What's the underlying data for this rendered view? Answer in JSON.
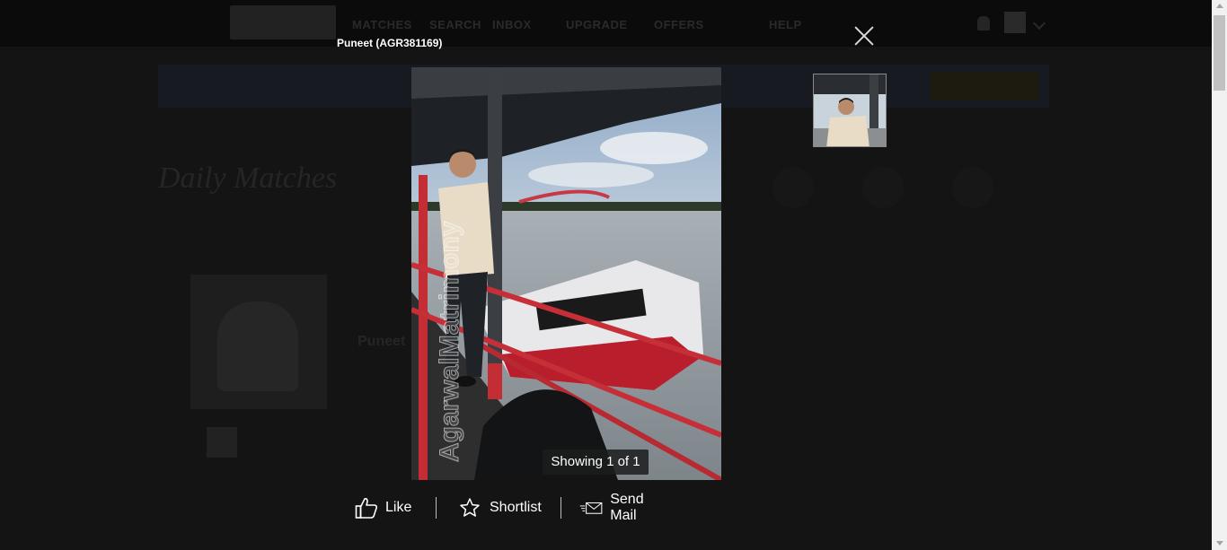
{
  "modal": {
    "title": "Puneet (AGR381169)",
    "caption": "Showing 1 of 1",
    "actions": {
      "like": "Like",
      "shortlist": "Shortlist",
      "send_mail": "Send Mail"
    },
    "watermark": "AgarwalMatrimony"
  },
  "background_page": {
    "nav": [
      "MATCHES",
      "SEARCH",
      "INBOX",
      "UPGRADE",
      "OFFERS",
      "HELP"
    ],
    "heading": "Daily Matches",
    "profile_name": "Puneet"
  },
  "icons": {
    "close": "close-icon",
    "like": "thumbs-up-icon",
    "shortlist": "star-icon",
    "send_mail": "envelope-icon"
  }
}
